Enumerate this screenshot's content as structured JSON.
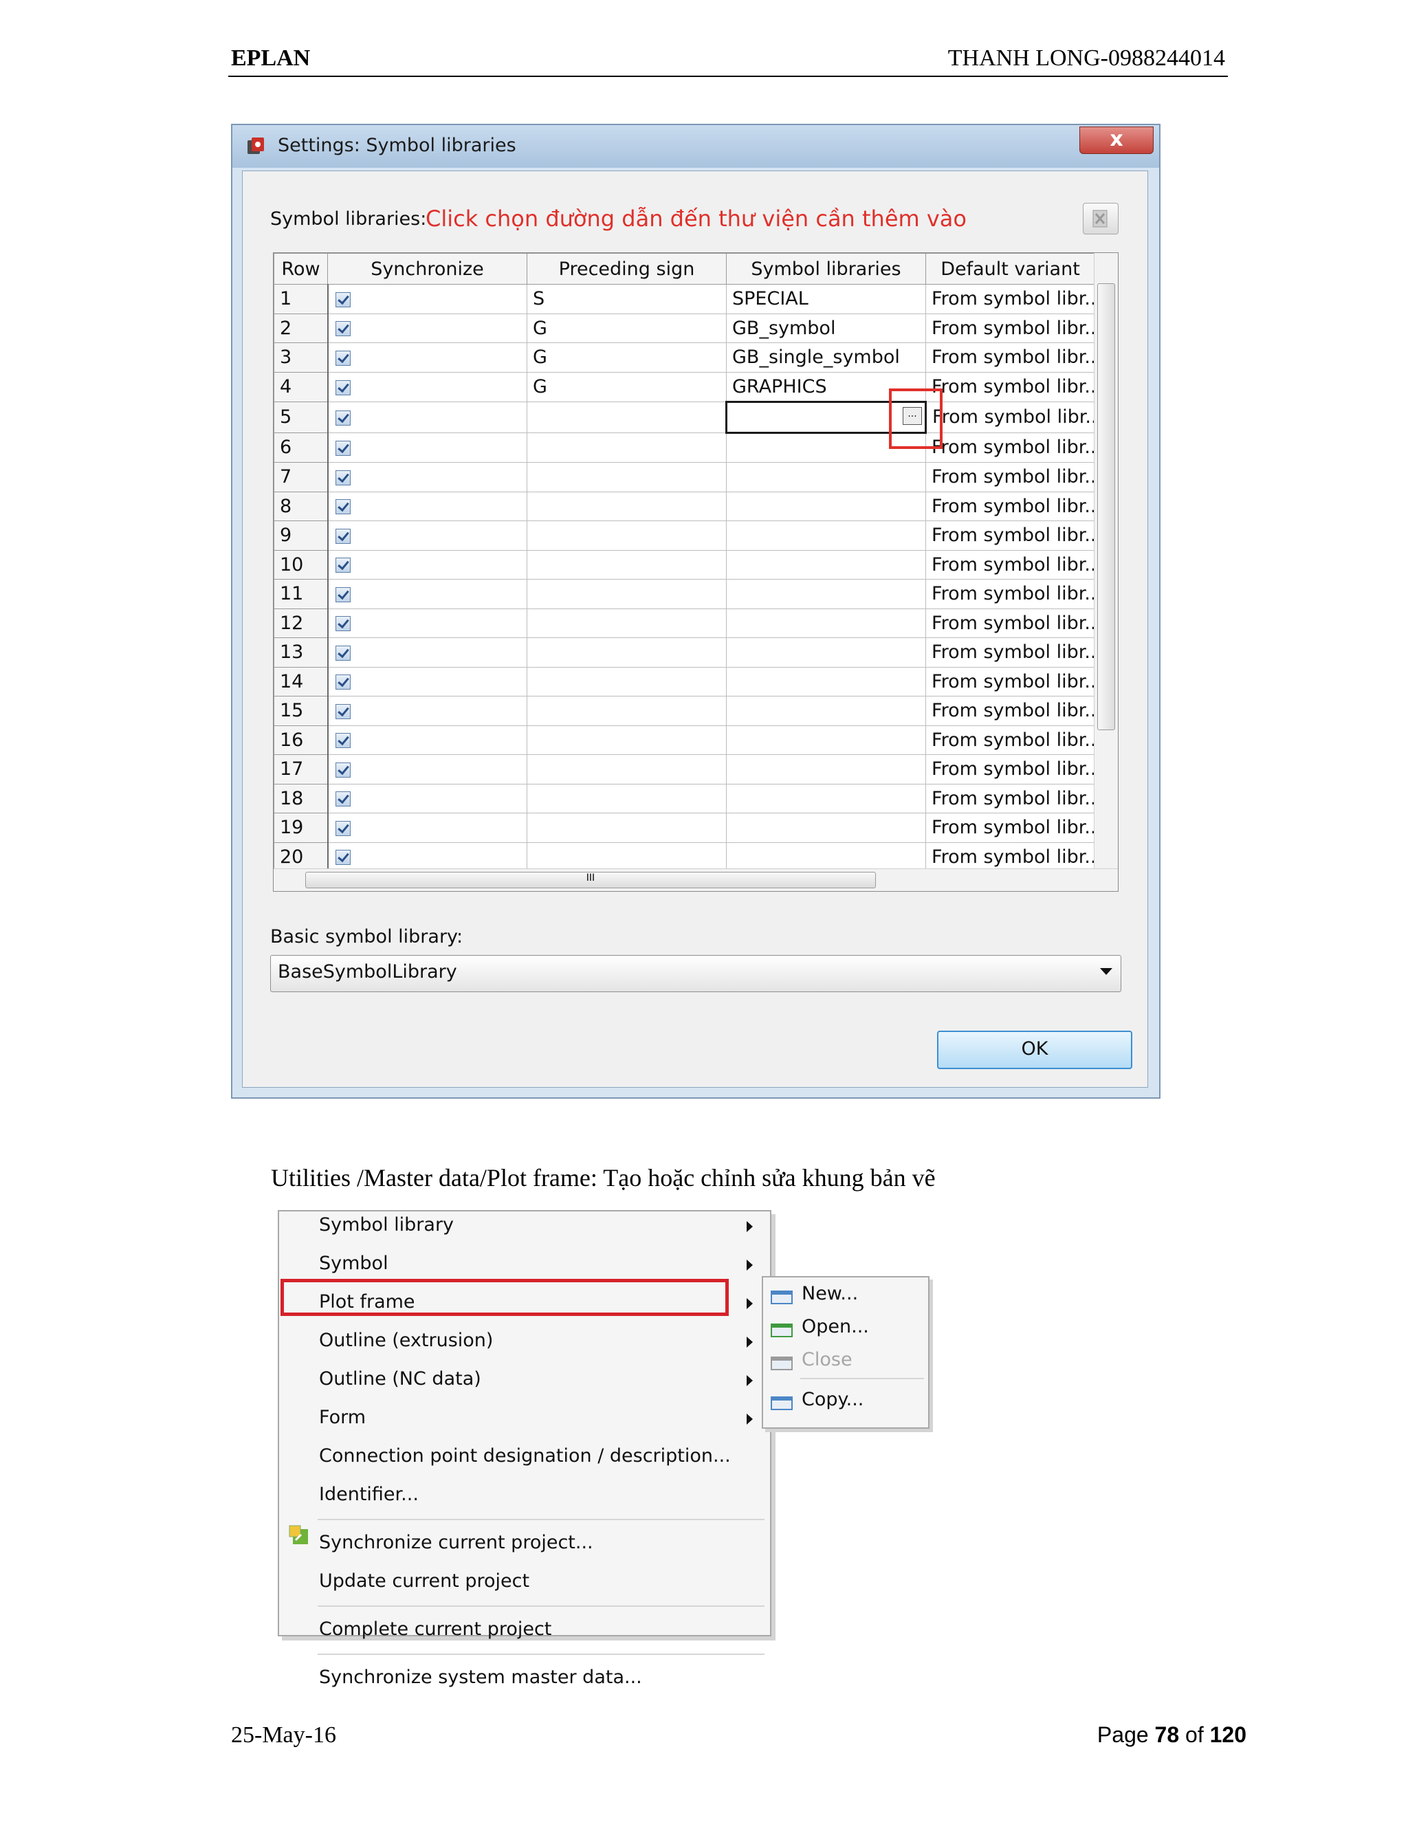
{
  "page": {
    "header_left": "EPLAN",
    "header_right": "THANH LONG-0988244014",
    "footer_date": "25-May-16",
    "footer_page_prefix": "Page ",
    "footer_page_num": "78",
    "footer_page_of": " of ",
    "footer_page_total": "120",
    "caption": "Utilities /Master data/Plot frame: Tạo hoặc chỉnh sửa khung bản vẽ"
  },
  "dialog": {
    "title": "Settings: Symbol libraries",
    "close_label": "x",
    "symbol_libraries_label": "Symbol libraries:",
    "annotation": "Click chọn đường dẫn đến thư viện cần thêm vào",
    "columns": [
      "Row",
      "Synchronize",
      "Preceding sign",
      "Symbol libraries",
      "Default variant"
    ],
    "rows": [
      {
        "row": "1",
        "sign": "S",
        "lib": "SPECIAL",
        "variant": "From symbol libr.."
      },
      {
        "row": "2",
        "sign": "G",
        "lib": "GB_symbol",
        "variant": "From symbol libr.."
      },
      {
        "row": "3",
        "sign": "G",
        "lib": "GB_single_symbol",
        "variant": "From symbol libr.."
      },
      {
        "row": "4",
        "sign": "G",
        "lib": "GRAPHICS",
        "variant": "From symbol libr.."
      },
      {
        "row": "5",
        "sign": "",
        "lib": "",
        "variant": "From symbol libr.."
      },
      {
        "row": "6",
        "sign": "",
        "lib": "",
        "variant": "From symbol libr.."
      },
      {
        "row": "7",
        "sign": "",
        "lib": "",
        "variant": "From symbol libr.."
      },
      {
        "row": "8",
        "sign": "",
        "lib": "",
        "variant": "From symbol libr.."
      },
      {
        "row": "9",
        "sign": "",
        "lib": "",
        "variant": "From symbol libr.."
      },
      {
        "row": "10",
        "sign": "",
        "lib": "",
        "variant": "From symbol libr.."
      },
      {
        "row": "11",
        "sign": "",
        "lib": "",
        "variant": "From symbol libr.."
      },
      {
        "row": "12",
        "sign": "",
        "lib": "",
        "variant": "From symbol libr.."
      },
      {
        "row": "13",
        "sign": "",
        "lib": "",
        "variant": "From symbol libr.."
      },
      {
        "row": "14",
        "sign": "",
        "lib": "",
        "variant": "From symbol libr.."
      },
      {
        "row": "15",
        "sign": "",
        "lib": "",
        "variant": "From symbol libr.."
      },
      {
        "row": "16",
        "sign": "",
        "lib": "",
        "variant": "From symbol libr.."
      },
      {
        "row": "17",
        "sign": "",
        "lib": "",
        "variant": "From symbol libr.."
      },
      {
        "row": "18",
        "sign": "",
        "lib": "",
        "variant": "From symbol libr.."
      },
      {
        "row": "19",
        "sign": "",
        "lib": "",
        "variant": "From symbol libr.."
      },
      {
        "row": "20",
        "sign": "",
        "lib": "",
        "variant": "From symbol libr.."
      }
    ],
    "ellipsis_label": "...",
    "hscroll_grip": "III",
    "basic_label": "Basic symbol library:",
    "basic_value": "BaseSymbolLibrary",
    "ok_label": "OK",
    "icons": {
      "title": "settings-icon",
      "delete": "delete-icon"
    }
  },
  "menu": {
    "items": [
      {
        "label": "Symbol library",
        "submenu": true
      },
      {
        "label": "Symbol",
        "submenu": true
      },
      {
        "label": "Plot frame",
        "submenu": true,
        "highlighted": true
      },
      {
        "label": "Outline (extrusion)",
        "submenu": true
      },
      {
        "label": "Outline (NC data)",
        "submenu": true
      },
      {
        "label": "Form",
        "submenu": true
      },
      {
        "label": "Connection point designation / description...",
        "submenu": false
      },
      {
        "label": "Identifier...",
        "submenu": false
      },
      {
        "label": "Synchronize current project...",
        "submenu": false
      },
      {
        "label": "Update current project",
        "submenu": false
      },
      {
        "label": "Complete current project",
        "submenu": false
      },
      {
        "label": "Synchronize system master data...",
        "submenu": false
      }
    ],
    "submenu": [
      {
        "label": "New...",
        "enabled": true,
        "icon": "new-icon"
      },
      {
        "label": "Open...",
        "enabled": true,
        "icon": "open-icon"
      },
      {
        "label": "Close",
        "enabled": false,
        "icon": "close-folder-icon"
      },
      {
        "label": "Copy...",
        "enabled": true,
        "icon": "copy-icon"
      }
    ],
    "highlight_color": "#d5222a"
  }
}
